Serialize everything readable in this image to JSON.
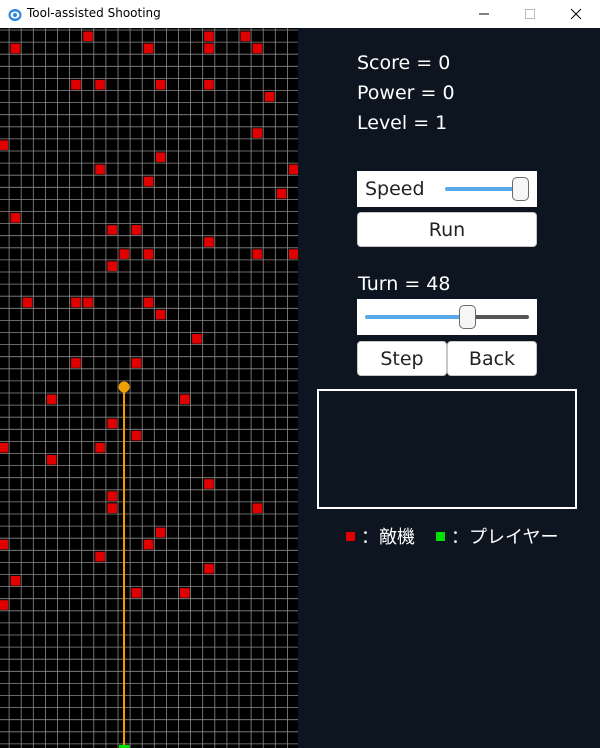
{
  "window": {
    "title": "Tool-assisted Shooting",
    "controls": [
      "minimize",
      "maximize",
      "close"
    ]
  },
  "colors": {
    "enemy": "#e00000",
    "player": "#00e000",
    "laser": "#f0a000",
    "grid": "#8a8a8a",
    "panel_bg": "#0c1520",
    "accent": "#5aa8ea"
  },
  "panel": {
    "score_text": "Score = 0",
    "power_text": "Power = 0",
    "level_text": "Level = 1",
    "speed_label": "Speed",
    "speed_value": 0.95,
    "run_label": "Run",
    "turn_text": "Turn = 48",
    "turn_value": 0.6,
    "step_label": "Step",
    "back_label": "Back",
    "output_text": "",
    "legend": {
      "enemy_text": "：敵機",
      "player_text": "：プレイヤー"
    }
  },
  "game": {
    "enemies": [
      [
        7,
        0
      ],
      [
        17,
        0
      ],
      [
        20,
        0
      ],
      [
        1,
        1
      ],
      [
        12,
        1
      ],
      [
        17,
        1
      ],
      [
        21,
        1
      ],
      [
        6,
        4
      ],
      [
        8,
        4
      ],
      [
        13,
        4
      ],
      [
        17,
        4
      ],
      [
        22,
        5
      ],
      [
        21,
        8
      ],
      [
        0,
        9
      ],
      [
        13,
        10
      ],
      [
        8,
        11
      ],
      [
        24,
        11
      ],
      [
        12,
        12
      ],
      [
        23,
        13
      ],
      [
        1,
        15
      ],
      [
        9,
        16
      ],
      [
        11,
        16
      ],
      [
        17,
        17
      ],
      [
        10,
        18
      ],
      [
        12,
        18
      ],
      [
        21,
        18
      ],
      [
        24,
        18
      ],
      [
        9,
        19
      ],
      [
        2,
        22
      ],
      [
        6,
        22
      ],
      [
        7,
        22
      ],
      [
        12,
        22
      ],
      [
        13,
        23
      ],
      [
        16,
        25
      ],
      [
        6,
        27
      ],
      [
        11,
        27
      ],
      [
        4,
        30
      ],
      [
        15,
        30
      ],
      [
        9,
        32
      ],
      [
        11,
        33
      ],
      [
        0,
        34
      ],
      [
        8,
        34
      ],
      [
        4,
        35
      ],
      [
        17,
        37
      ],
      [
        9,
        38
      ],
      [
        9,
        39
      ],
      [
        21,
        39
      ],
      [
        13,
        41
      ],
      [
        0,
        42
      ],
      [
        12,
        42
      ],
      [
        8,
        43
      ],
      [
        17,
        44
      ],
      [
        1,
        45
      ],
      [
        0,
        47
      ],
      [
        11,
        46
      ],
      [
        15,
        46
      ]
    ],
    "player": [
      10,
      59
    ],
    "laser_top_row": 29
  }
}
